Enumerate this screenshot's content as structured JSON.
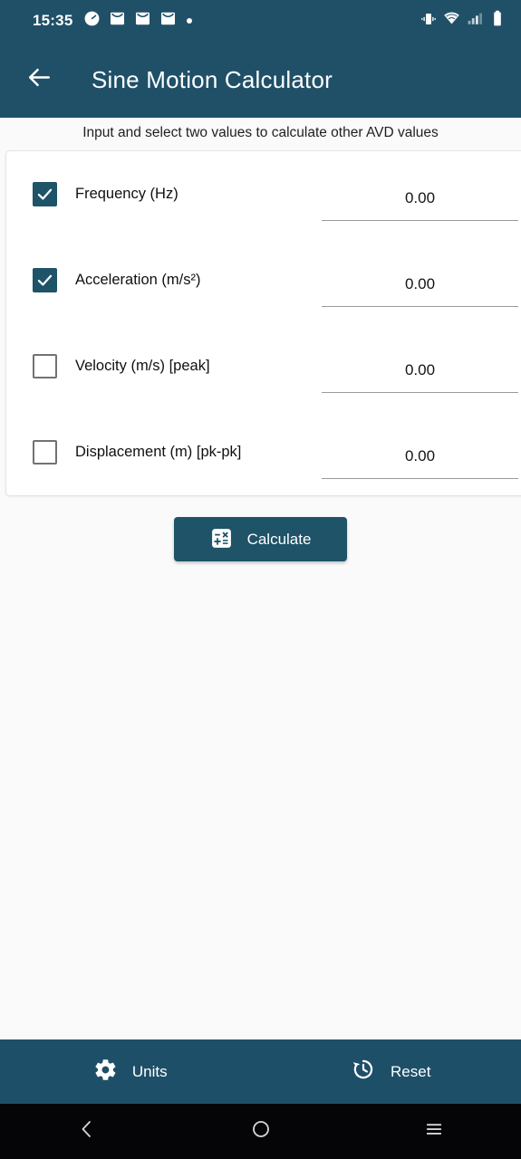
{
  "status_bar": {
    "time": "15:35",
    "icons_left": [
      "clock-icon",
      "mail-icon",
      "mail-icon",
      "mail-icon",
      "dot-icon"
    ],
    "icons_right": [
      "vibrate-icon",
      "wifi-icon",
      "signal-icon",
      "battery-icon"
    ]
  },
  "app_bar": {
    "back_icon": "back-arrow-icon",
    "title": "Sine Motion Calculator"
  },
  "main": {
    "subtitle": "Input and select two values to calculate other AVD values",
    "rows": [
      {
        "label": "Frequency (Hz)",
        "checked": true,
        "value": "0.00"
      },
      {
        "label": "Acceleration (m/s²)",
        "checked": true,
        "value": "0.00"
      },
      {
        "label": "Velocity (m/s) [peak]",
        "checked": false,
        "value": "0.00"
      },
      {
        "label": "Displacement (m) [pk-pk]",
        "checked": false,
        "value": "0.00"
      }
    ],
    "calculate_button": {
      "label": "Calculate",
      "icon": "calculator-icon"
    }
  },
  "bottom_bar": {
    "items": [
      {
        "label": "Units",
        "icon": "gear-icon"
      },
      {
        "label": "Reset",
        "icon": "history-restore-icon"
      }
    ]
  },
  "nav_bar": {
    "items": [
      {
        "icon": "back-chevron-icon"
      },
      {
        "icon": "home-circle-icon"
      },
      {
        "icon": "recents-menu-icon"
      }
    ]
  },
  "colors": {
    "primary": "#1f5068",
    "accent": "#1e5368",
    "page_background": "#fafafa",
    "card_background": "#ffffff",
    "nav_background": "#050507"
  }
}
